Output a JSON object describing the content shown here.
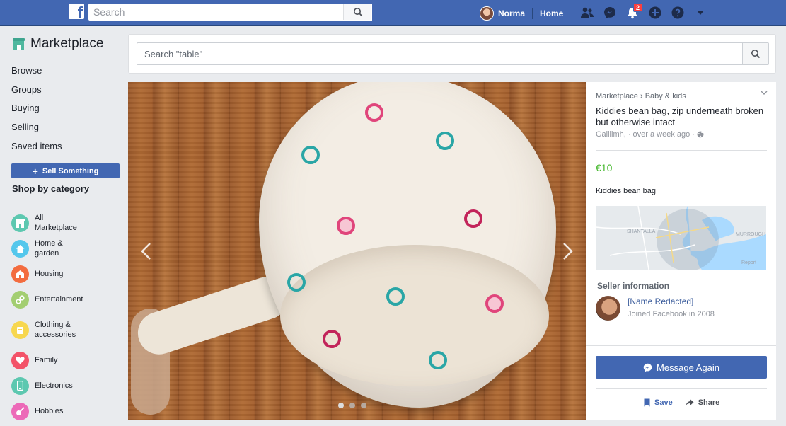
{
  "topbar": {
    "search_placeholder": "Search",
    "user_name": "Norma",
    "home_label": "Home",
    "notification_count": "2",
    "brand_color": "#4267b2"
  },
  "sidebar": {
    "title": "Marketplace",
    "links": [
      "Browse",
      "Groups",
      "Buying",
      "Selling",
      "Saved items"
    ],
    "sell_button": "Sell Something",
    "shop_by_category": "Shop by category",
    "categories": [
      {
        "label": "All Marketplace",
        "icon": "store-icon",
        "color": "#5dc8b0"
      },
      {
        "label": "Home & garden",
        "icon": "house-icon",
        "color": "#54c7ec"
      },
      {
        "label": "Housing",
        "icon": "housing-icon",
        "color": "#f36c3f"
      },
      {
        "label": "Entertainment",
        "icon": "link-icon",
        "color": "#a3ce71"
      },
      {
        "label": "Clothing & accessories",
        "icon": "clothing-icon",
        "color": "#f7d74f"
      },
      {
        "label": "Family",
        "icon": "heart-icon",
        "color": "#f35369"
      },
      {
        "label": "Electronics",
        "icon": "phone-icon",
        "color": "#5dc8b0"
      },
      {
        "label": "Hobbies",
        "icon": "guitar-icon",
        "color": "#ec6ab8"
      }
    ]
  },
  "search": {
    "placeholder": "Search \"table\""
  },
  "listing": {
    "breadcrumb_root": "Marketplace",
    "breadcrumb_sep": "›",
    "breadcrumb_cat": "Baby & kids",
    "title": "Kiddies bean bag, zip underneath broken but otherwise intact",
    "location": "Gaillimh,",
    "posted": "· over a week ago ·",
    "price": "€10",
    "description": "Kiddies bean bag",
    "map_label_1": "SHANTALLA",
    "map_label_2": "MURROUGH",
    "map_report": "Report",
    "seller_heading": "Seller information",
    "seller_name": "[Name Redacted]",
    "seller_joined": "Joined Facebook in 2008",
    "message_button": "Message Again",
    "save_label": "Save",
    "share_label": "Share",
    "photo_index": 1,
    "photo_count": 3
  }
}
